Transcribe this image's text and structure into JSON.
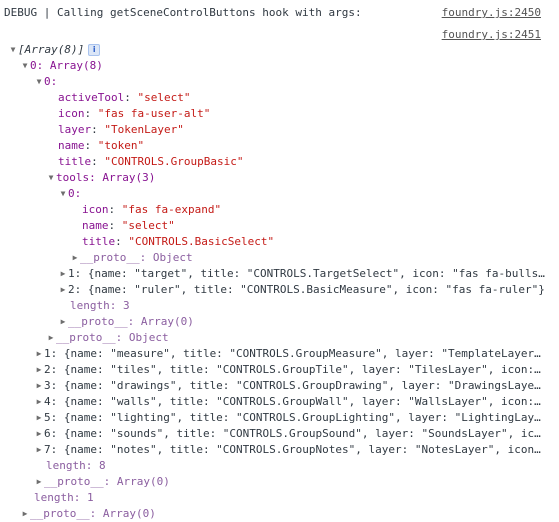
{
  "debug_message": "DEBUG | Calling getSceneControlButtons hook with args:",
  "source_links": [
    "foundry.js:2450",
    "foundry.js:2451"
  ],
  "root_label": "[Array(8)]",
  "info_badge": "i",
  "item0_label": "0: Array(8)",
  "group0_label": "0:",
  "group0_props": [
    {
      "key": "activeTool",
      "value": "\"select\""
    },
    {
      "key": "icon",
      "value": "\"fas fa-user-alt\""
    },
    {
      "key": "layer",
      "value": "\"TokenLayer\""
    },
    {
      "key": "name",
      "value": "\"token\""
    },
    {
      "key": "title",
      "value": "\"CONTROLS.GroupBasic\""
    }
  ],
  "tools_label": "tools: Array(3)",
  "tool0_label": "0:",
  "tool0_props": [
    {
      "key": "icon",
      "value": "\"fas fa-expand\""
    },
    {
      "key": "name",
      "value": "\"select\""
    },
    {
      "key": "title",
      "value": "\"CONTROLS.BasicSelect\""
    }
  ],
  "tool0_proto": "__proto__: Object",
  "tool1_line": "1: {name: \"target\", title: \"CONTROLS.TargetSelect\", icon: \"fas fa-bulls…",
  "tool2_line": "2: {name: \"ruler\", title: \"CONTROLS.BasicMeasure\", icon: \"fas fa-ruler\"}",
  "tools_length": "length: 3",
  "tools_proto": "__proto__: Array(0)",
  "group0_proto": "__proto__: Object",
  "groups": [
    "1: {name: \"measure\", title: \"CONTROLS.GroupMeasure\", layer: \"TemplateLayer…",
    "2: {name: \"tiles\", title: \"CONTROLS.GroupTile\", layer: \"TilesLayer\", icon:…",
    "3: {name: \"drawings\", title: \"CONTROLS.GroupDrawing\", layer: \"DrawingsLaye…",
    "4: {name: \"walls\", title: \"CONTROLS.GroupWall\", layer: \"WallsLayer\", icon:…",
    "5: {name: \"lighting\", title: \"CONTROLS.GroupLighting\", layer: \"LightingLay…",
    "6: {name: \"sounds\", title: \"CONTROLS.GroupSound\", layer: \"SoundsLayer\", ic…",
    "7: {name: \"notes\", title: \"CONTROLS.GroupNotes\", layer: \"NotesLayer\", icon…"
  ],
  "item0_length": "length: 8",
  "item0_proto": "__proto__: Array(0)",
  "root_length": "length: 1",
  "root_proto": "__proto__: Array(0)"
}
